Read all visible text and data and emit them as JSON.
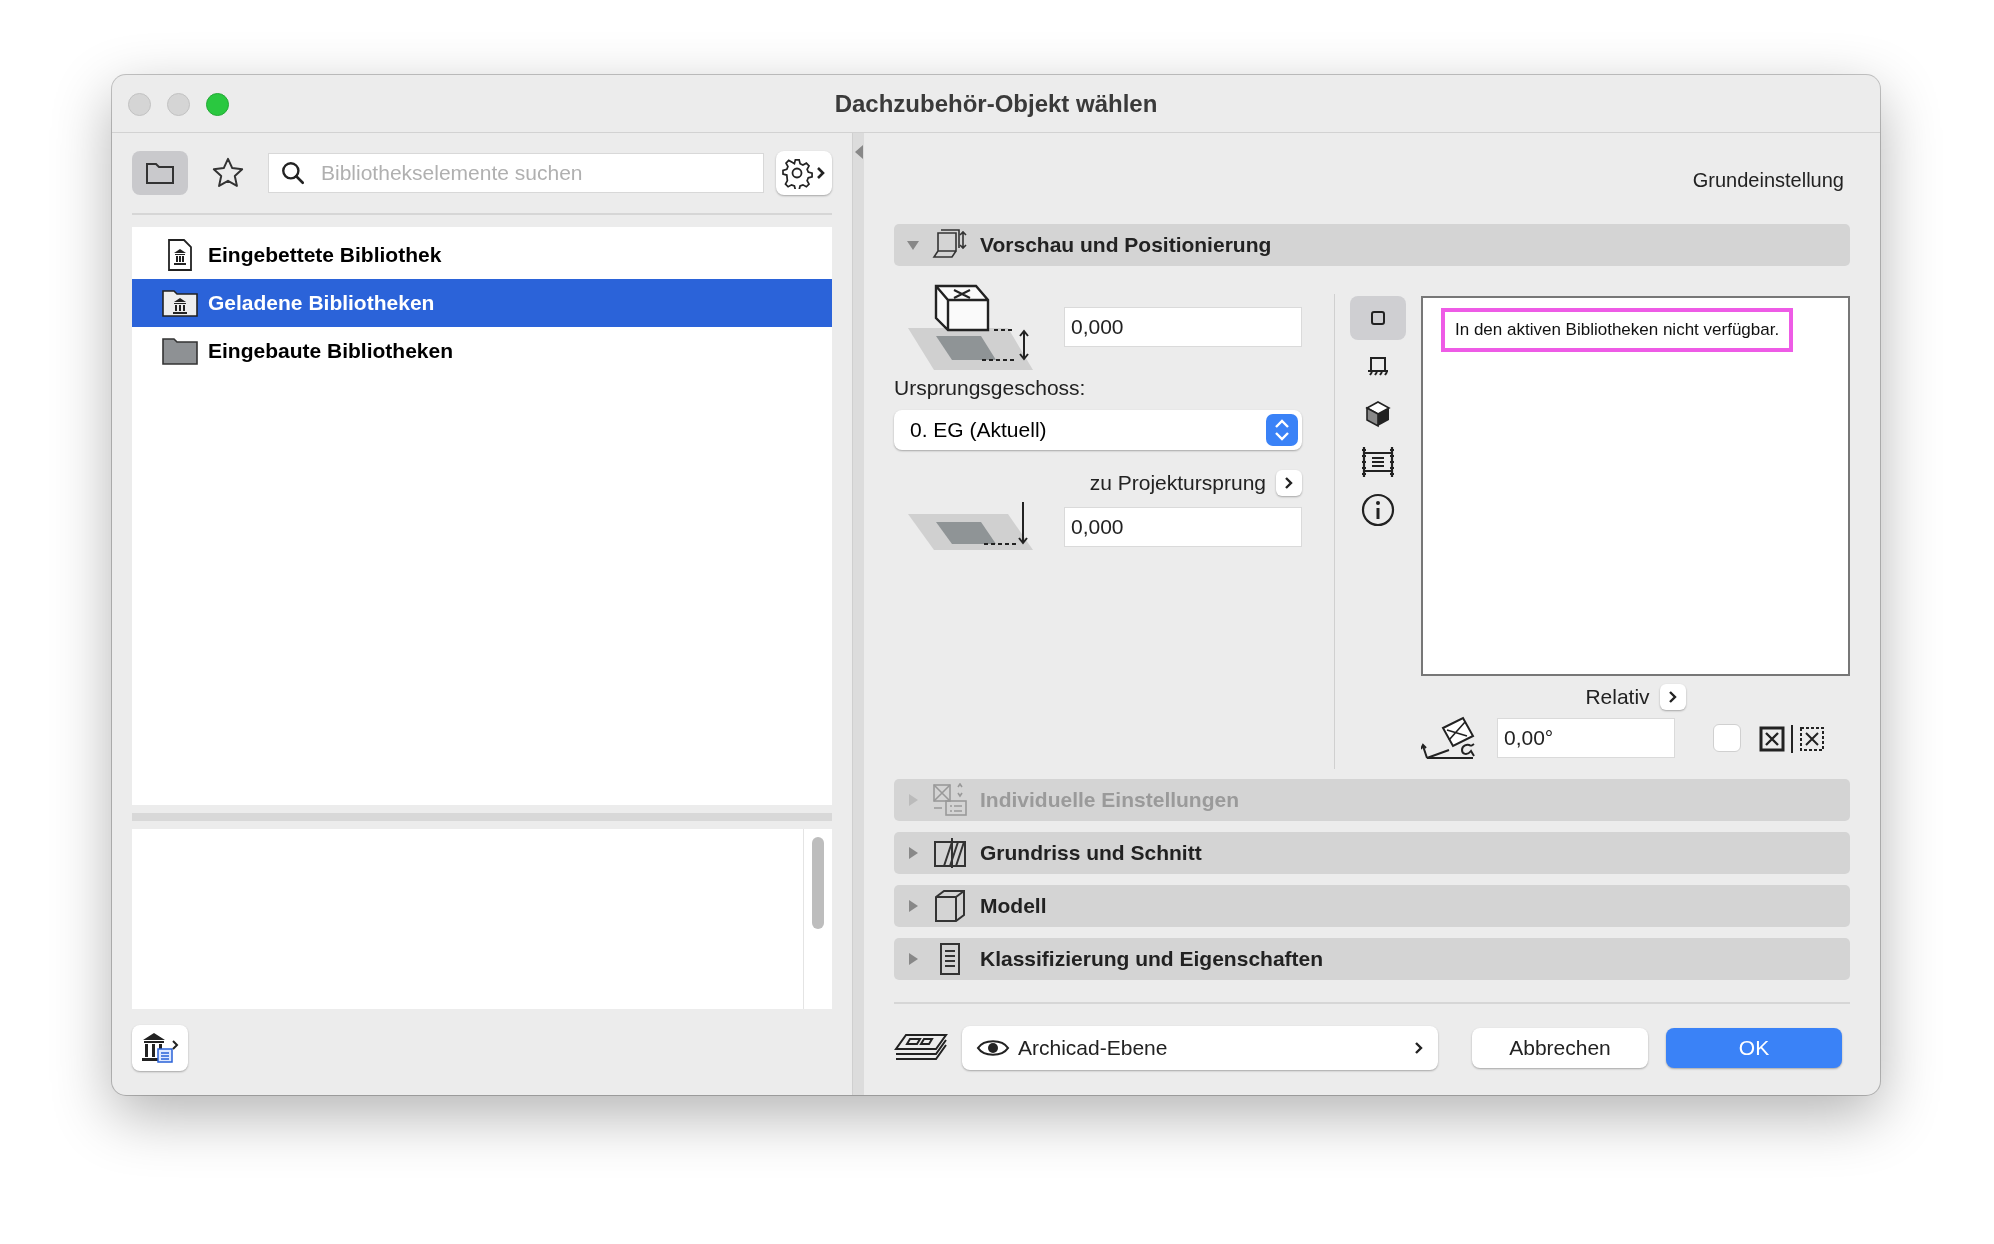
{
  "window": {
    "title": "Dachzubehör-Objekt wählen"
  },
  "library_browser": {
    "view_buttons": [
      {
        "kind": "folder",
        "selected": true
      },
      {
        "kind": "favorites",
        "selected": false
      }
    ],
    "search": {
      "placeholder": "Bibliothekselemente suchen"
    },
    "tree": [
      {
        "label": "Eingebettete Bibliothek",
        "kind": "embedded",
        "selected": false
      },
      {
        "label": "Geladene Bibliotheken",
        "kind": "loaded",
        "selected": true
      },
      {
        "label": "Eingebaute Bibliotheken",
        "kind": "builtin",
        "selected": false
      }
    ]
  },
  "settings_label": "Grundeinstellung",
  "sections": [
    {
      "title": "Vorschau und Positionierung",
      "kind": "preview",
      "expanded": true,
      "disabled": false
    },
    {
      "title": "Individuelle Einstellungen",
      "kind": "custom",
      "expanded": false,
      "disabled": true
    },
    {
      "title": "Grundriss und Schnitt",
      "kind": "plan",
      "expanded": false,
      "disabled": false
    },
    {
      "title": "Modell",
      "kind": "model",
      "expanded": false,
      "disabled": false
    },
    {
      "title": "Klassifizierung und Eigenschaften",
      "kind": "classification",
      "expanded": false,
      "disabled": false
    }
  ],
  "positioning": {
    "elevation": "0,000",
    "home_story_label": "Ursprungsgeschoss:",
    "home_story": "0. EG (Aktuell)",
    "reference_label": "zu Projektursprung",
    "reference_elevation": "0,000"
  },
  "preview": {
    "view_modes": [
      {
        "kind": "plan",
        "selected": true
      },
      {
        "kind": "symbol",
        "selected": false
      },
      {
        "kind": "cube",
        "selected": false
      },
      {
        "kind": "section",
        "selected": false
      },
      {
        "kind": "info",
        "selected": false
      }
    ],
    "message": "In den aktiven Bibliotheken nicht verfügbar.",
    "message_highlighted": true,
    "relative_label": "Relativ",
    "angle": "0,00°",
    "mirror_checked": false
  },
  "footer": {
    "layer": "Archicad-Ebene",
    "layer_visible": true,
    "buttons": [
      {
        "label": "Abbrechen",
        "kind": "cancel"
      },
      {
        "label": "OK",
        "kind": "default"
      }
    ]
  }
}
